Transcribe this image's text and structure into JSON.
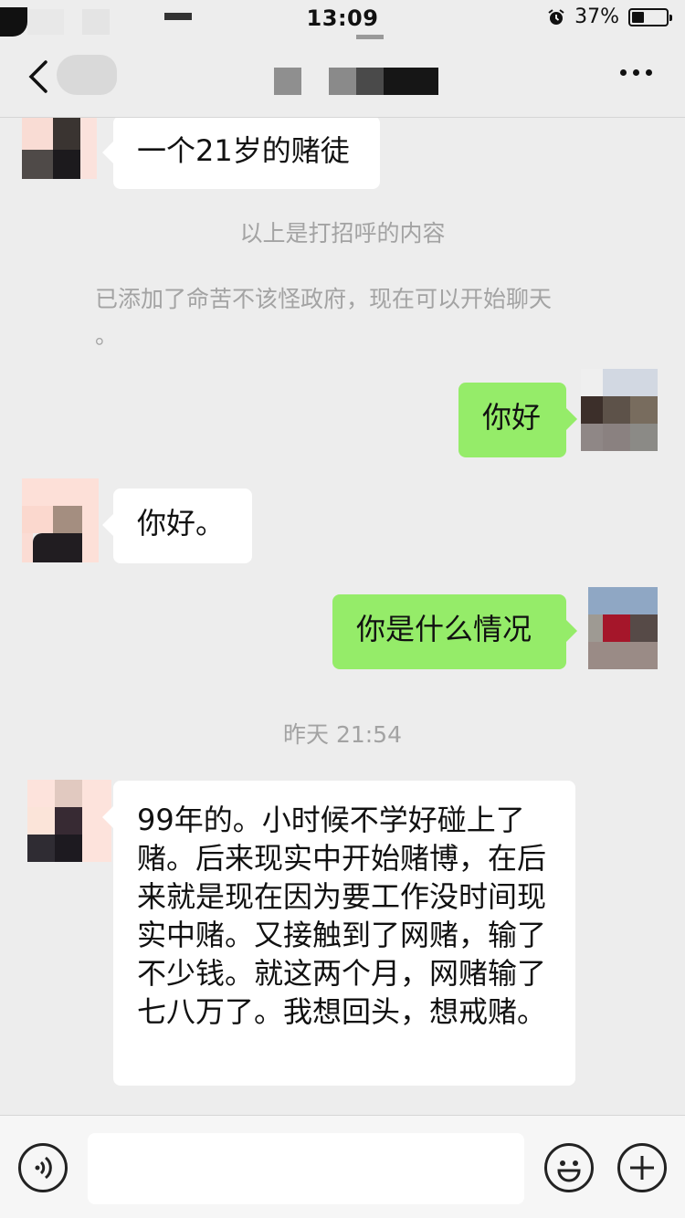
{
  "status_bar": {
    "time": "13:09",
    "battery": "37%",
    "battery_level": 0.37
  },
  "nav": {
    "back_icon": "chevron-left-icon",
    "more_icon": "more-dots-icon"
  },
  "messages": {
    "m1": "一个21岁的赌徒",
    "sys1": "以上是打招呼的内容",
    "sys2_line1": "已添加了命苦不该怪政府，现在可以开始聊天",
    "sys2_line2": "。",
    "m2": "你好",
    "m3": "你好。",
    "m4": "你是什么情况",
    "timestamp": "昨天 21:54",
    "m5": "99年的。小时候不学好碰上了赌。后来现实中开始赌博，在后来就是现在因为要工作没时间现实中赌。又接触到了网赌，输了不少钱。就这两个月，网赌输了七八万了。我想回头，想戒赌。"
  },
  "input_bar": {
    "voice_icon": "voice-icon",
    "emoji_icon": "emoji-icon",
    "plus_icon": "plus-icon"
  },
  "colors": {
    "outgoing_bubble": "#95ec69",
    "incoming_bubble": "#ffffff",
    "background": "#ededed"
  }
}
